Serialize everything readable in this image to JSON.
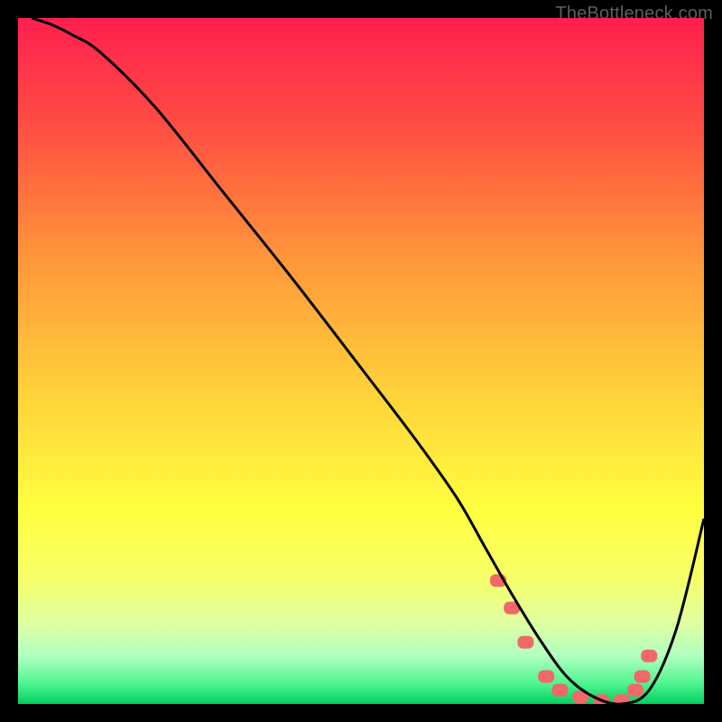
{
  "attribution": "TheBottleneck.com",
  "chart_data": {
    "type": "line",
    "title": "",
    "xlabel": "",
    "ylabel": "",
    "xlim": [
      0,
      100
    ],
    "ylim": [
      0,
      100
    ],
    "background": {
      "type": "vertical-gradient",
      "stops": [
        {
          "offset": 0,
          "color": "#ff1f4f"
        },
        {
          "offset": 15,
          "color": "#ff4b43"
        },
        {
          "offset": 35,
          "color": "#ff963a"
        },
        {
          "offset": 55,
          "color": "#ffd33a"
        },
        {
          "offset": 72,
          "color": "#ffff3f"
        },
        {
          "offset": 82,
          "color": "#f6ff6a"
        },
        {
          "offset": 88,
          "color": "#e0ffa0"
        },
        {
          "offset": 93,
          "color": "#b0ffc0"
        },
        {
          "offset": 97,
          "color": "#50f590"
        },
        {
          "offset": 100,
          "color": "#00d060"
        }
      ]
    },
    "series": [
      {
        "name": "curve",
        "color": "#000000",
        "x": [
          2,
          5,
          8,
          12,
          20,
          30,
          40,
          50,
          58,
          64,
          68,
          72,
          76,
          80,
          84,
          88,
          92,
          96,
          100
        ],
        "y": [
          100,
          99,
          97.5,
          95,
          87,
          74.5,
          62,
          49,
          38.5,
          30,
          23,
          16,
          9.5,
          4,
          1,
          0,
          2,
          11,
          27
        ]
      }
    ],
    "markers": {
      "name": "optimal-band",
      "color": "#f06868",
      "points": [
        {
          "x": 70,
          "y": 18
        },
        {
          "x": 72,
          "y": 14
        },
        {
          "x": 74,
          "y": 9
        },
        {
          "x": 77,
          "y": 4
        },
        {
          "x": 79,
          "y": 2
        },
        {
          "x": 82,
          "y": 1
        },
        {
          "x": 85,
          "y": 0.5
        },
        {
          "x": 88,
          "y": 0.5
        },
        {
          "x": 90,
          "y": 2
        },
        {
          "x": 91,
          "y": 4
        },
        {
          "x": 92,
          "y": 7
        }
      ]
    }
  }
}
